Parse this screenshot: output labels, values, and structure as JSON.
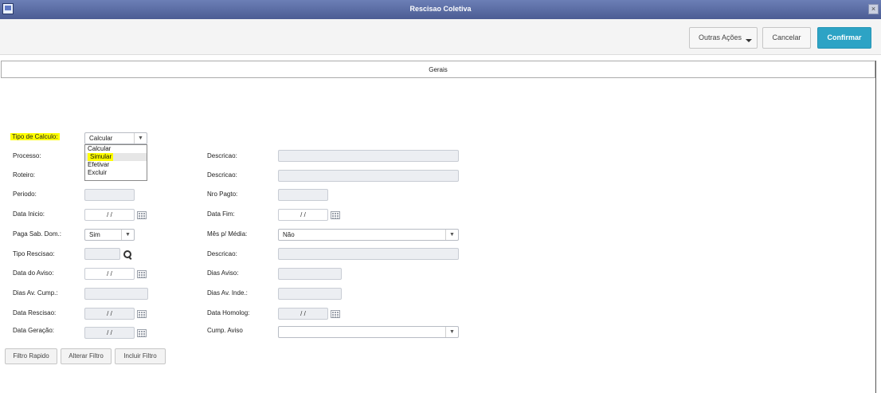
{
  "window": {
    "title": "Rescisao Coletiva",
    "close_glyph": "×"
  },
  "toolbar": {
    "outras_label": "Outras Ações",
    "cancel_label": "Cancelar",
    "confirm_label": "Confirmar",
    "accent": "#2da3c5"
  },
  "tabs": [
    {
      "label": "Gerais"
    }
  ],
  "form": {
    "tipo_calculo": {
      "label": "Tipo de Calculo:",
      "value": "Calcular",
      "options": [
        "Calcular",
        "Simular",
        "Efetivar",
        "Excluir"
      ]
    },
    "processo_label": "Processo:",
    "processo_desc_label": "Descricao:",
    "roteiro_label": "Roteiro:",
    "roteiro_desc_label": "Descricao:",
    "periodo_label": "Periodo:",
    "nro_pagto_label": "Nro Pagto:",
    "data_inicio_label": "Data Inicio:",
    "data_inicio_value": "/ /",
    "data_fim_label": "Data Fim:",
    "data_fim_value": "/ /",
    "paga_sab_label": "Paga Sab. Dom.:",
    "paga_sab_value": "Sim",
    "mes_media_label": "Mês p/ Média:",
    "mes_media_value": "Não",
    "tipo_rescisao_label": "Tipo Rescisao:",
    "tipo_rescisao_desc_label": "Descricao:",
    "data_aviso_label": "Data do Aviso:",
    "data_aviso_value": "/ /",
    "dias_aviso_label": "Dias Aviso:",
    "dias_av_cump_label": "Dias Av. Cump.:",
    "dias_av_inde_label": "Dias Av. Inde.:",
    "data_rescisao_label": "Data Rescisao:",
    "data_rescisao_value": "/ /",
    "data_homolog_label": "Data Homolog:",
    "data_homolog_value": "/ /",
    "data_geracao_label": "Data Geração:",
    "data_geracao_value": "/ /",
    "cump_aviso_label": "Cump. Aviso",
    "cump_aviso_value": "",
    "select_arrow": "▼"
  },
  "filters": {
    "filtro_rapido": "Filtro Rapido",
    "alterar_filtro": "Alterar Filtro",
    "incluir_filtro": "Incluir Filtro"
  }
}
